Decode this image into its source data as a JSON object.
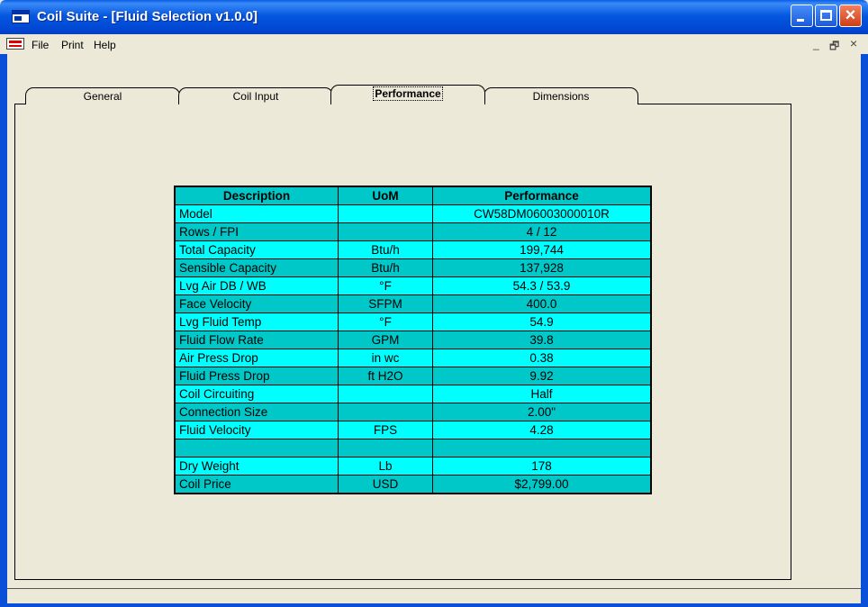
{
  "window": {
    "title": "Coil Suite - [Fluid Selection v1.0.0]",
    "controls": {
      "minimize": "minimize-icon",
      "maximize": "maximize-icon",
      "close": "close-icon"
    }
  },
  "menu": {
    "file": "File",
    "print": "Print",
    "help": "Help"
  },
  "mdi_controls": {
    "minimize": "_",
    "restore": "🗗",
    "close": "×"
  },
  "tabs": {
    "general": "General",
    "coil_input": "Coil Input",
    "performance": "Performance",
    "dimensions": "Dimensions",
    "active": "Performance"
  },
  "colors": {
    "row_light": "#00ffff",
    "row_dark": "#00c8c8",
    "border": "#000000"
  },
  "table": {
    "headers": {
      "description": "Description",
      "uom": "UoM",
      "performance": "Performance"
    },
    "rows": [
      {
        "desc": "Model",
        "uom": "",
        "value": "CW58DM06003000010R"
      },
      {
        "desc": "Rows / FPI",
        "uom": "",
        "value": "4 / 12"
      },
      {
        "desc": "Total Capacity",
        "uom": "Btu/h",
        "value": "199,744"
      },
      {
        "desc": "Sensible Capacity",
        "uom": "Btu/h",
        "value": "137,928"
      },
      {
        "desc": "Lvg Air DB / WB",
        "uom": "°F",
        "value": "54.3 / 53.9"
      },
      {
        "desc": "Face Velocity",
        "uom": "SFPM",
        "value": "400.0"
      },
      {
        "desc": "Lvg Fluid Temp",
        "uom": "°F",
        "value": "54.9"
      },
      {
        "desc": "Fluid Flow Rate",
        "uom": "GPM",
        "value": "39.8"
      },
      {
        "desc": "Air Press Drop",
        "uom": "in wc",
        "value": "0.38"
      },
      {
        "desc": "Fluid Press Drop",
        "uom": "ft H2O",
        "value": "9.92"
      },
      {
        "desc": "Coil Circuiting",
        "uom": "",
        "value": "Half"
      },
      {
        "desc": "Connection Size",
        "uom": "",
        "value": "2.00\""
      },
      {
        "desc": "Fluid Velocity",
        "uom": "FPS",
        "value": "4.28"
      },
      {
        "desc": "",
        "uom": "",
        "value": ""
      },
      {
        "desc": "Dry Weight",
        "uom": "Lb",
        "value": "178"
      },
      {
        "desc": "Coil Price",
        "uom": "USD",
        "value": "$2,799.00"
      }
    ]
  }
}
